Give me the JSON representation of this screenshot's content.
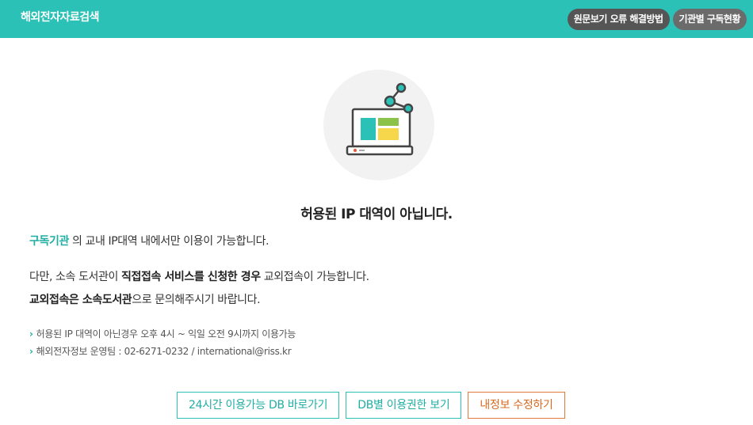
{
  "header": {
    "title": "해외전자자료검색",
    "buttons": [
      "원문보기 오류 해결방법",
      "기관별 구독현황"
    ]
  },
  "colors": {
    "brand": "#2bc1b6",
    "accent_text": "#1faea3",
    "orange": "#e07b3b"
  },
  "illustration": {
    "icon": "laptop-share-icon"
  },
  "message": {
    "title": "허용된 IP 대역이 아닙니다.",
    "line1_highlight": "구독기관",
    "line1_rest": " 의 교내 IP대역 내에서만 이용이 가능합니다.",
    "line2_prefix": "다만, 소속 도서관이 ",
    "line2_bold": "직접접속 서비스를 신청한 경우",
    "line2_suffix": " 교외접속이 가능합니다.",
    "line3_bold1": "교외접속은 소속도서관",
    "line3_suffix": "으로 문의해주시기 바랍니다."
  },
  "notes": [
    "허용된 IP 대역이 아닌경우 오후 4시 ~ 익일 오전 9시까지 이용가능",
    "해외전자정보 운영팀 : 02-6271-0232 / international@riss.kr"
  ],
  "buttons": {
    "db24": "24시간 이용가능 DB 바로가기",
    "db_rights": "DB별 이용권한 보기",
    "edit_info": "내정보 수정하기"
  }
}
